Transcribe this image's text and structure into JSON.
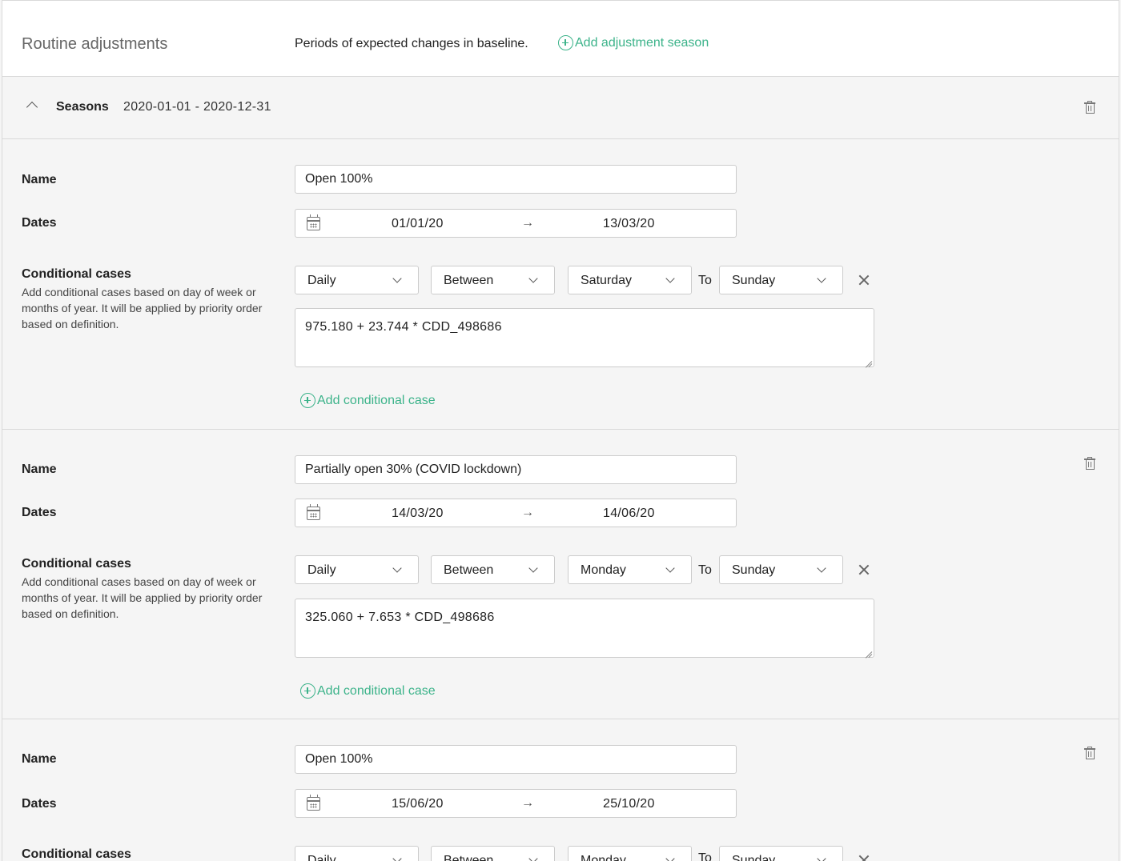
{
  "header": {
    "title": "Routine adjustments",
    "description": "Periods of expected changes in baseline.",
    "add_season_label": "Add adjustment season"
  },
  "seasons": {
    "label": "Seasons",
    "range": "2020-01-01 - 2020-12-31"
  },
  "labels": {
    "name": "Name",
    "dates": "Dates",
    "conditional_cases": "Conditional cases",
    "conditional_help": "Add conditional cases based on day of week or months of year. It will be applied by priority order based on definition.",
    "to": "To",
    "add_conditional_case": "Add conditional case",
    "date_arrow": "→"
  },
  "items": [
    {
      "name": "Open 100%",
      "date_start": "01/01/20",
      "date_end": "13/03/20",
      "case": {
        "frequency": "Daily",
        "operator": "Between",
        "from": "Saturday",
        "to": "Sunday",
        "formula": "975.180 + 23.744 * CDD_498686"
      }
    },
    {
      "name": "Partially open 30% (COVID lockdown)",
      "date_start": "14/03/20",
      "date_end": "14/06/20",
      "case": {
        "frequency": "Daily",
        "operator": "Between",
        "from": "Monday",
        "to": "Sunday",
        "formula": "325.060 + 7.653 * CDD_498686"
      }
    },
    {
      "name": "Open 100%",
      "date_start": "15/06/20",
      "date_end": "25/10/20",
      "case": {
        "frequency": "Daily",
        "operator": "Between",
        "from": "Monday",
        "to": "Sunday"
      }
    }
  ],
  "colors": {
    "accent": "#3cb38a",
    "background": "#f5f5f5",
    "border": "#d9d9d9"
  },
  "icons": [
    "plus-circle-icon",
    "chevron-up-icon",
    "trash-icon",
    "calendar-icon",
    "arrow-right-icon",
    "chevron-down-icon",
    "close-icon",
    "resize-handle-icon"
  ]
}
